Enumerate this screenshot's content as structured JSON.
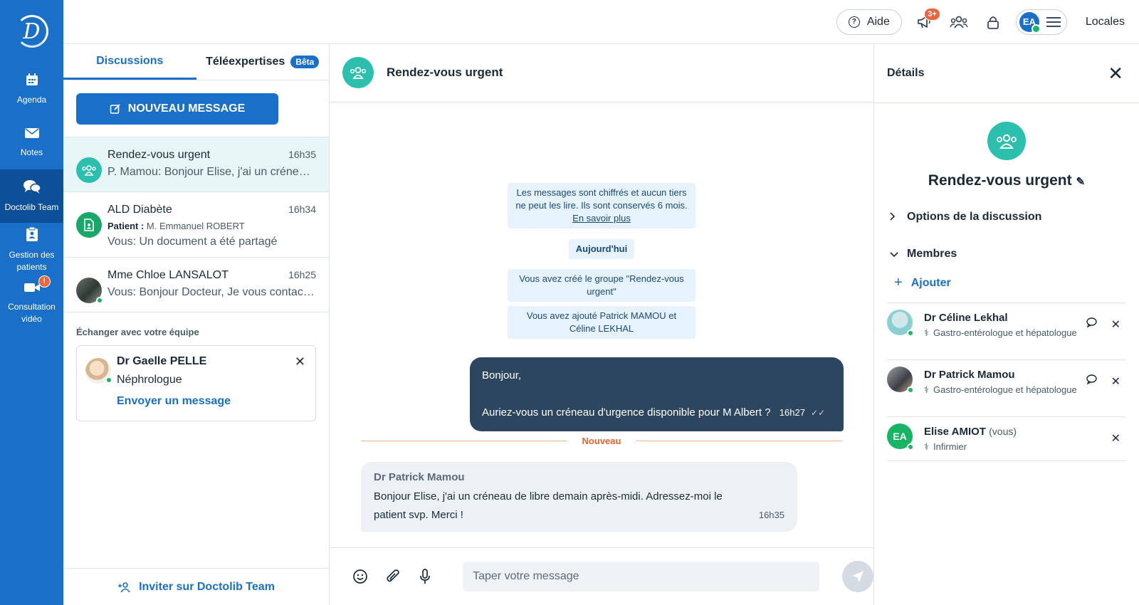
{
  "nav": {
    "logo_letter": "D",
    "items": [
      {
        "label": "Agenda",
        "icon": "calendar-icon"
      },
      {
        "label": "Notes",
        "icon": "envelope-icon"
      },
      {
        "label": "Doctolib Team",
        "icon": "chat-bubbles-icon",
        "active": true
      },
      {
        "label": "Gestion des patients",
        "icon": "clipboard-icon"
      },
      {
        "label": "Consultation vidéo",
        "icon": "video-icon",
        "badge": "!"
      }
    ]
  },
  "topbar": {
    "help_label": "Aide",
    "announcements_badge": "3+",
    "account_initials": "EA",
    "locales_label": "Locales"
  },
  "discussions": {
    "tabs": [
      {
        "label": "Discussions",
        "active": true
      },
      {
        "label": "Téléexpertises",
        "badge": "Bêta"
      }
    ],
    "new_message_label": "NOUVEAU MESSAGE",
    "conversations": [
      {
        "name": "Rendez-vous urgent",
        "time": "16h35",
        "preview": "P. Mamou: Bonjour Elise, j'ai un créneau de libre demain après-midi. Adressez-moi le patient svp. Merci !"
      },
      {
        "name": "ALD Diabète",
        "time": "16h34",
        "patient_label": "Patient :",
        "patient_name": "M. Emmanuel ROBERT",
        "preview": "Vous: Un document a été partagé"
      },
      {
        "name": "Mme Chloe LANSALOT",
        "time": "16h25",
        "preview": "Vous: Bonjour Docteur, Je vous contacte au sujet de votre patiente"
      }
    ],
    "team_section_title": "Échanger avec votre équipe",
    "team_card": {
      "name": "Dr Gaelle PELLE",
      "specialty": "Néphrologue",
      "action_label": "Envoyer un message"
    },
    "invite_label": "Inviter sur Doctolib Team"
  },
  "chat": {
    "title": "Rendez-vous urgent",
    "encryption_notice": "Les messages sont chiffrés et aucun tiers ne peut les lire. Ils sont conservés 6 mois.",
    "learn_more": "En savoir plus",
    "date_label": "Aujourd'hui",
    "system_messages": [
      "Vous avez créé le groupe \"Rendez-vous urgent\"",
      "Vous avez ajouté Patrick MAMOU et Céline LEKHAL"
    ],
    "outgoing": {
      "line1": "Bonjour,",
      "line2": "Auriez-vous un créneau d'urgence disponible pour M Albert ?",
      "time": "16h27",
      "ticks": "✓✓"
    },
    "new_separator": "Nouveau",
    "incoming": {
      "author": "Dr Patrick Mamou",
      "text": "Bonjour Elise, j'ai un créneau de libre demain après-midi. Adressez-moi le patient svp. Merci !",
      "time": "16h35"
    },
    "composer_placeholder": "Taper votre message"
  },
  "details": {
    "title": "Détails",
    "group_name": "Rendez-vous urgent",
    "options_label": "Options de la discussion",
    "members_label": "Membres",
    "add_label": "Ajouter",
    "members": [
      {
        "name": "Dr Céline Lekhal",
        "role": "Gastro-entérologue et hépatologue",
        "you": ""
      },
      {
        "name": "Dr Patrick Mamou",
        "role": "Gastro-entérologue et hépatologue",
        "you": ""
      },
      {
        "name": "Elise AMIOT",
        "role": "Infirmier",
        "you": "(vous)",
        "initials": "EA"
      }
    ]
  },
  "colors": {
    "brand_blue": "#1a70c8",
    "nav_active": "#0d4f99",
    "teal": "#2bbfae",
    "online_green": "#18b466",
    "alert_orange": "#f0643c",
    "outgoing_bubble": "#2d4660"
  }
}
